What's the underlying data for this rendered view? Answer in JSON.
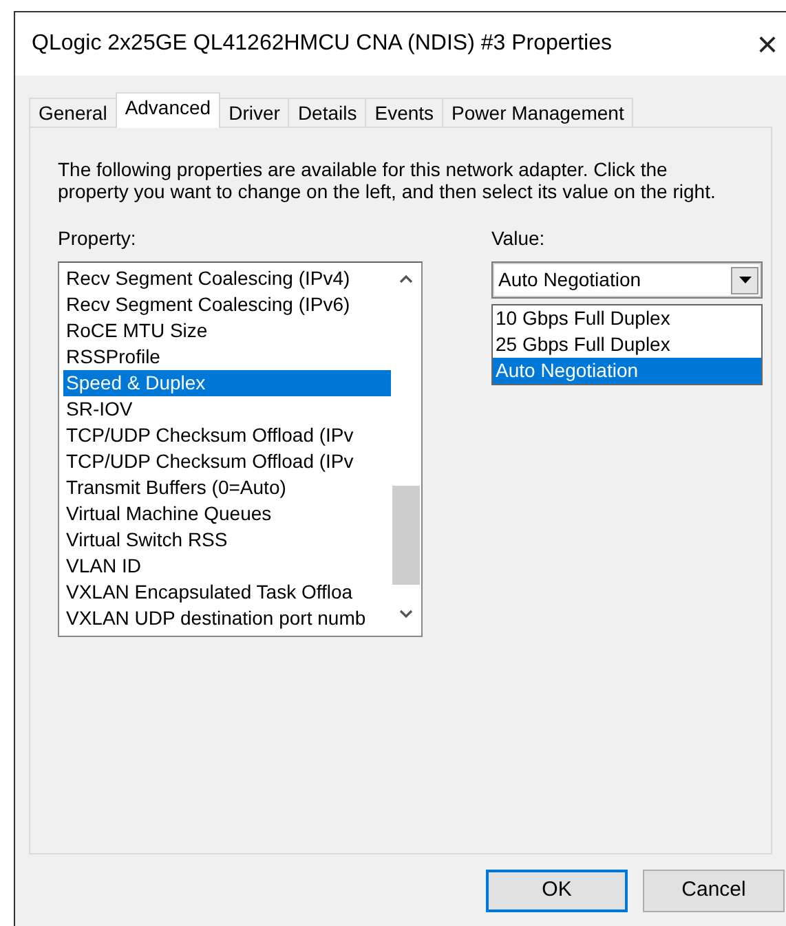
{
  "window": {
    "title": "QLogic 2x25GE QL41262HMCU CNA (NDIS) #3 Properties",
    "close": "×"
  },
  "tabs": [
    {
      "label": "General",
      "selected": false
    },
    {
      "label": "Advanced",
      "selected": true
    },
    {
      "label": "Driver",
      "selected": false
    },
    {
      "label": "Details",
      "selected": false
    },
    {
      "label": "Events",
      "selected": false
    },
    {
      "label": "Power Management",
      "selected": false
    }
  ],
  "description": "The following properties are available for this network adapter. Click the property you want to change on the left, and then select its value on the right.",
  "property": {
    "label": "Property:",
    "items": [
      {
        "label": "Recv Segment Coalescing (IPv4)",
        "selected": false
      },
      {
        "label": "Recv Segment Coalescing (IPv6)",
        "selected": false
      },
      {
        "label": "RoCE MTU Size",
        "selected": false
      },
      {
        "label": "RSSProfile",
        "selected": false
      },
      {
        "label": "Speed & Duplex",
        "selected": true
      },
      {
        "label": "SR-IOV",
        "selected": false
      },
      {
        "label": "TCP/UDP Checksum Offload (IPv",
        "selected": false
      },
      {
        "label": "TCP/UDP Checksum Offload (IPv",
        "selected": false
      },
      {
        "label": "Transmit Buffers (0=Auto)",
        "selected": false
      },
      {
        "label": "Virtual Machine Queues",
        "selected": false
      },
      {
        "label": "Virtual Switch RSS",
        "selected": false
      },
      {
        "label": "VLAN ID",
        "selected": false
      },
      {
        "label": "VXLAN Encapsulated Task Offloa",
        "selected": false
      },
      {
        "label": "VXLAN UDP destination port numb",
        "selected": false
      }
    ]
  },
  "value": {
    "label": "Value:",
    "current": "Auto Negotiation",
    "expanded": true,
    "options": [
      {
        "label": "10 Gbps Full Duplex",
        "selected": false
      },
      {
        "label": "25 Gbps Full Duplex",
        "selected": false
      },
      {
        "label": "Auto Negotiation",
        "selected": true
      }
    ]
  },
  "buttons": [
    {
      "label": "OK",
      "default": true
    },
    {
      "label": "Cancel",
      "default": false
    }
  ]
}
